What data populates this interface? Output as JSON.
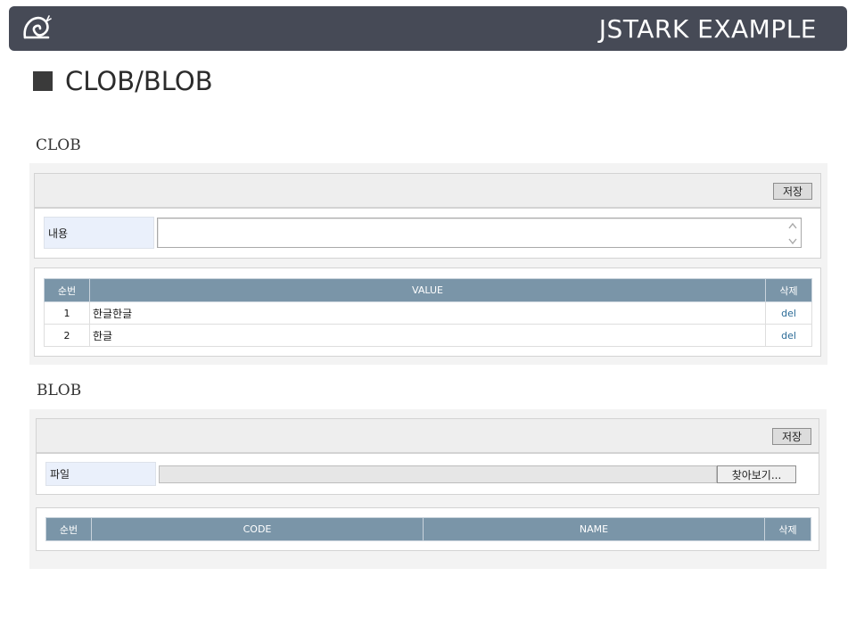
{
  "header": {
    "app_title": "JSTARK EXAMPLE",
    "logo_icon": "snail-icon",
    "bar_color": "#464a56"
  },
  "page_title": "CLOB/BLOB",
  "clob": {
    "section_label": "CLOB",
    "save_label": "저장",
    "content_label": "내용",
    "content_value": "",
    "table": {
      "headers": [
        "순번",
        "VALUE",
        "삭제"
      ],
      "rows": [
        {
          "no": "1",
          "value": "한글한글",
          "action": "del"
        },
        {
          "no": "2",
          "value": "한글",
          "action": "del"
        }
      ]
    }
  },
  "blob": {
    "section_label": "BLOB",
    "save_label": "저장",
    "file_label": "파일",
    "browse_label": "찾아보기...",
    "table": {
      "headers": [
        "순번",
        "CODE",
        "NAME",
        "삭제"
      ],
      "rows": []
    }
  },
  "colors": {
    "table_header": "#7a95a8",
    "label_bg": "#eaf0fb",
    "link": "#2a6a96"
  }
}
